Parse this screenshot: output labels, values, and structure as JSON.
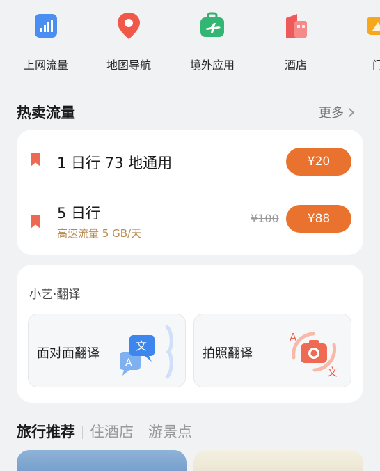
{
  "quick_access": [
    {
      "label": "上网流量",
      "icon": "signal-bars-icon"
    },
    {
      "label": "地图导航",
      "icon": "map-pin-icon"
    },
    {
      "label": "境外应用",
      "icon": "suitcase-plane-icon"
    },
    {
      "label": "酒店",
      "icon": "hotel-building-icon"
    },
    {
      "label": "门",
      "icon": "ticket-icon"
    }
  ],
  "hot_data": {
    "title": "热卖流量",
    "more_label": "更多",
    "plans": [
      {
        "name": "1 日行  73 地通用",
        "price": "¥20"
      },
      {
        "name": "5 日行",
        "subtitle": "高速流量 5 GB/天",
        "original_price": "¥100",
        "price": "¥88"
      }
    ]
  },
  "translate": {
    "title": "小艺·翻译",
    "tiles": [
      {
        "label": "面对面翻译",
        "icon": "conversation-translate-icon"
      },
      {
        "label": "拍照翻译",
        "icon": "camera-translate-icon"
      }
    ]
  },
  "travel": {
    "tabs": [
      "旅行推荐",
      "住酒店",
      "游景点"
    ]
  },
  "colors": {
    "accent_orange": "#e9722e",
    "bookmark_red": "#ec6a52",
    "subtitle_gold": "#b98a4e",
    "background": "#f1f2f4"
  }
}
